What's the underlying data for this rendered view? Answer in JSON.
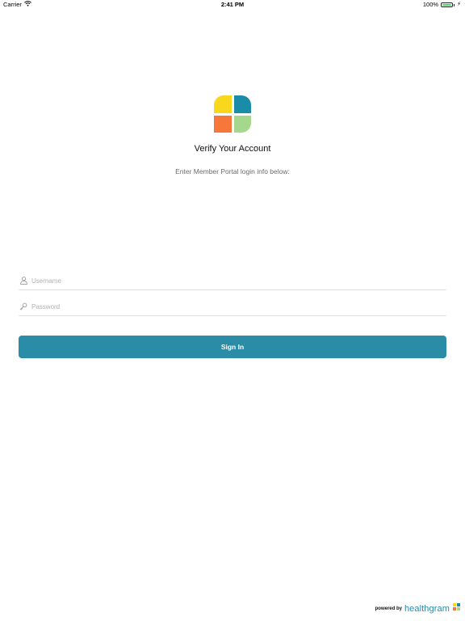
{
  "status_bar": {
    "carrier": "Carrier",
    "time": "2:41 PM",
    "battery": "100%"
  },
  "logo": {
    "colors": [
      "#f9d71c",
      "#1a8ca8",
      "#f7763a",
      "#a5d88c"
    ]
  },
  "header": {
    "title": "Verify Your Account",
    "subtitle": "Enter Member Portal login info below:"
  },
  "form": {
    "username_placeholder": "Username",
    "password_placeholder": "Password",
    "sign_in_label": "Sign In"
  },
  "footer": {
    "powered_by": "powered by",
    "brand": "healthgram"
  },
  "colors": {
    "accent": "#2b8ca8"
  }
}
